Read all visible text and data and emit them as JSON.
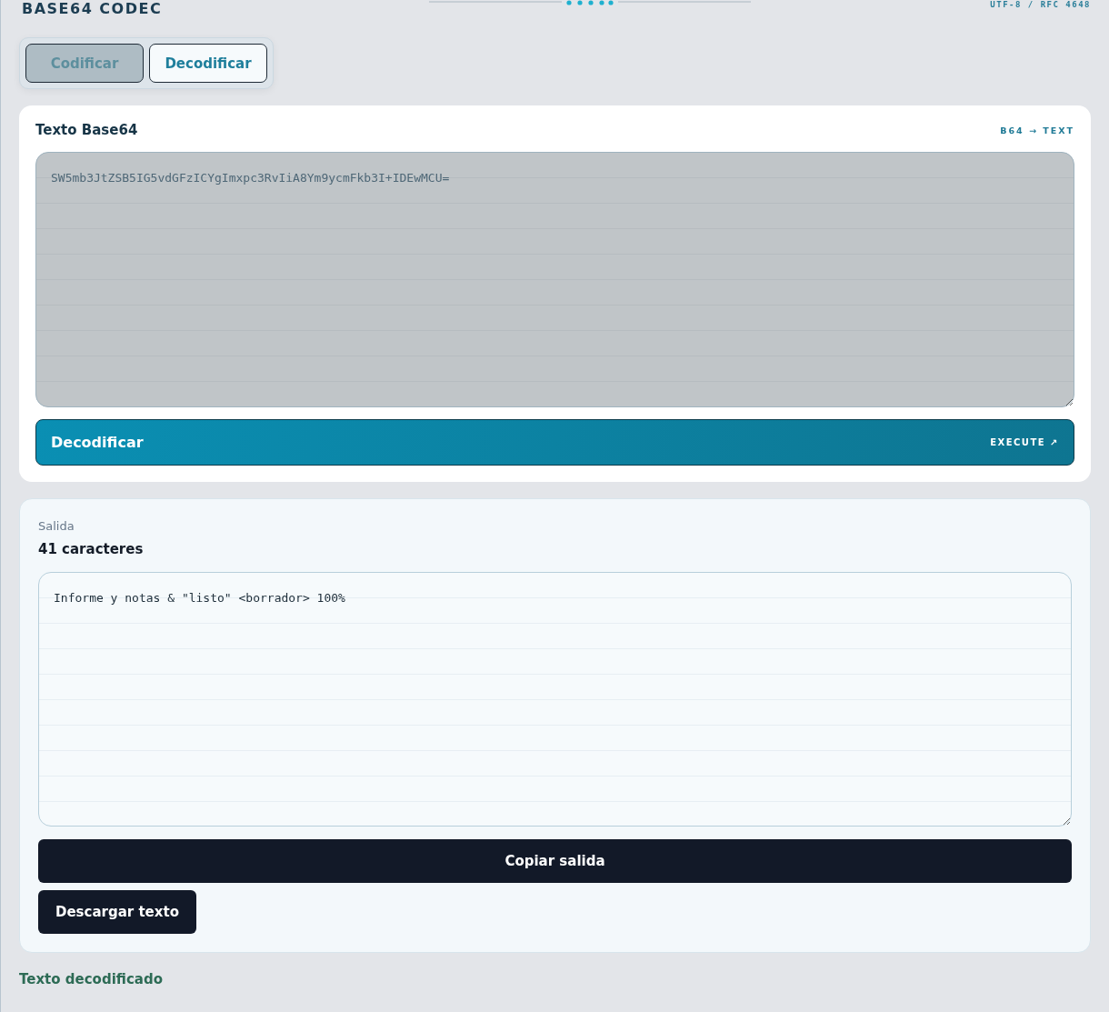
{
  "header": {
    "title": "BASE64 CODEC",
    "meta": "UTF-8 / RFC 4648"
  },
  "tabs": [
    {
      "label": "Codificar",
      "selected": false
    },
    {
      "label": "Decodificar",
      "selected": true
    }
  ],
  "input_card": {
    "title": "Texto Base64",
    "direction": "B64 → TEXT",
    "value": "SW5mb3JtZSB5IG5vdGFzICYgImxpc3RvIiA8Ym9ycmFkb3I+IDEwMCU=",
    "disabled": true,
    "action": {
      "label": "Decodificar",
      "hint": "EXECUTE ↗"
    }
  },
  "output_card": {
    "label": "Salida",
    "count": "41 caracteres",
    "value": "Informe y notas & \"listo\" <borrador> 100%",
    "buttons": [
      {
        "label": "Copiar salida",
        "kind": "wide"
      },
      {
        "label": "Descargar texto",
        "kind": "compact"
      }
    ]
  },
  "status": "Texto decodificado"
}
